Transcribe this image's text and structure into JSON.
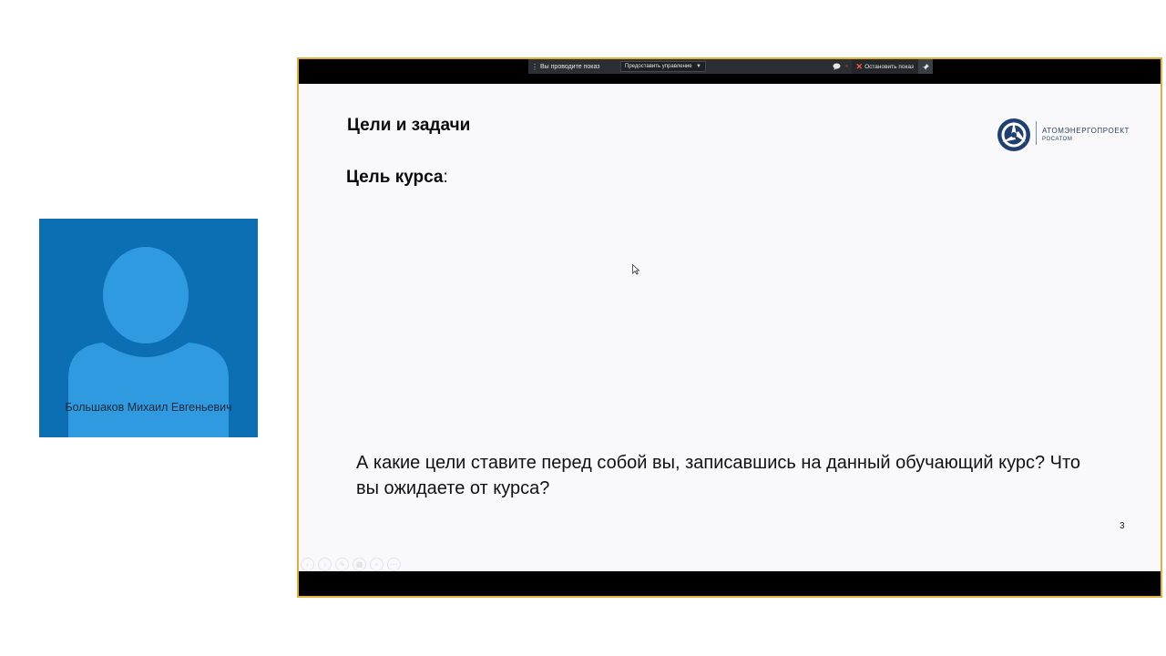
{
  "participant": {
    "name": "Большаков Михаил Евгеньевич",
    "tile_color": "#0d6fb3",
    "avatar_color": "#2f9ae0"
  },
  "share_toolbar": {
    "presenting_label": "Вы проводите показ",
    "give_control_label": "Предоставить управление",
    "stop_label": "Остановить показ",
    "icons": [
      "drag-grip-icon",
      "chevron-down-icon",
      "chat-icon",
      "close-icon",
      "pin-icon"
    ]
  },
  "slide": {
    "title": "Цели и задачи",
    "subtitle_bold": "Цель курса",
    "subtitle_tail": ":",
    "question": "А какие цели ставите перед собой вы, записавшись на данный обучающий курс? Что вы ожидаете от курса?",
    "page_number": "3",
    "logo": {
      "name": "АТОМЭНЕРГОПРОЕКТ",
      "sub": "РОСАТОМ",
      "color": "#1f3f73"
    },
    "tool_icons": [
      "arrow-left-icon",
      "arrow-right-icon",
      "pen-icon",
      "slides-grid-icon",
      "zoom-icon",
      "more-icon"
    ]
  },
  "frame_border_color": "#e0b13a"
}
